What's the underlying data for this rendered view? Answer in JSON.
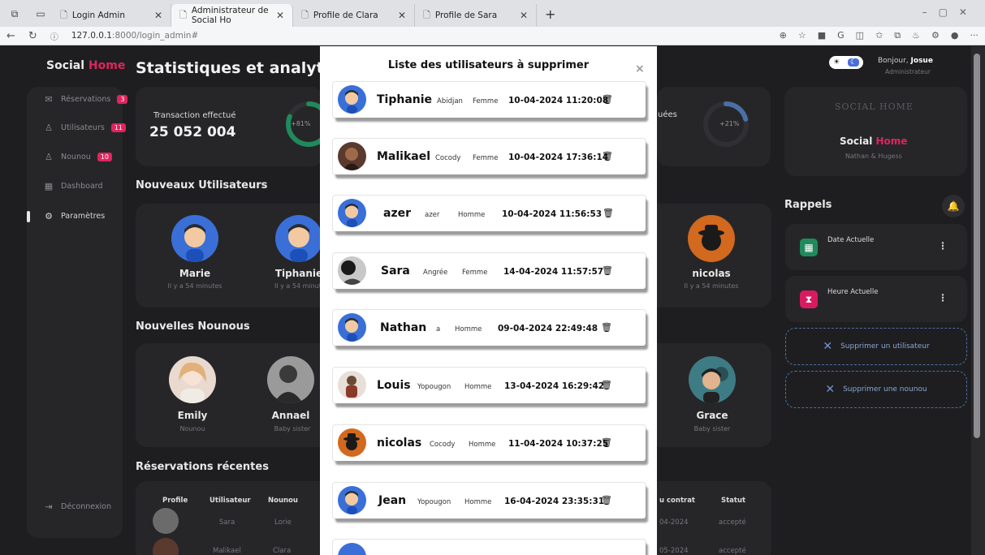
{
  "browser": {
    "tabs": [
      {
        "label": "Login Admin",
        "active": false
      },
      {
        "label": "Administrateur de Social Ho",
        "active": true
      },
      {
        "label": "Profile de Clara",
        "active": false
      },
      {
        "label": "Profile de Sara",
        "active": false
      }
    ],
    "url_host": "127.0.0.1",
    "url_rest": ":8000/login_admin#"
  },
  "app": {
    "brand_main": "Social",
    "brand_accent": "Home",
    "page_title": "Statistiques et analytique",
    "sidebar": [
      {
        "label": "Réservations",
        "badge": "3",
        "icon": "mail-icon"
      },
      {
        "label": "Utilisateurs",
        "badge": "11",
        "icon": "user-icon"
      },
      {
        "label": "Nounou",
        "badge": "10",
        "icon": "user-icon"
      },
      {
        "label": "Dashboard",
        "badge": "",
        "icon": "dashboard-icon"
      },
      {
        "label": "Paramètres",
        "badge": "",
        "icon": "gear-icon"
      },
      {
        "label": "Déconnexion",
        "badge": "",
        "icon": "logout-icon"
      }
    ],
    "stats": {
      "transaction_label": "Transaction effectué",
      "transaction_value": "25 052 004",
      "ring1_label": "+81%",
      "ring1_value": 81,
      "partial_label": "uées",
      "ring2_label": "+21%",
      "ring2_value": 21
    },
    "new_users_title": "Nouveaux Utilisateurs",
    "new_users": [
      {
        "name": "Marie",
        "sub": "Il y a 54 minutes"
      },
      {
        "name": "Tiphanie",
        "sub": "Il y a 54 minut"
      },
      {
        "name": "nicolas",
        "sub": "Il y a 54 minutes"
      }
    ],
    "new_nannies_title": "Nouvelles Nounous",
    "new_nannies": [
      {
        "name": "Emily",
        "sub": "Nounou"
      },
      {
        "name": "Annael",
        "sub": "Baby sister"
      },
      {
        "name": "Grace",
        "sub": "Baby sister"
      }
    ],
    "reservations_title": "Réservations récentes",
    "reservations_headers": [
      "Profile",
      "Utilisateur",
      "Nounou",
      "u contrat",
      "Statut"
    ],
    "reservations_rows": [
      {
        "user": "Sara",
        "nanny": "Lorie",
        "date": "04-2024",
        "status": "accepté"
      },
      {
        "user": "Malikael",
        "nanny": "Clara",
        "date": "05-2024",
        "status": "accepté"
      }
    ],
    "greeting_prefix": "Bonjour,",
    "greeting_name": "Josue",
    "role": "Administrateur",
    "profile_logo_text": "SOCIAL HOME",
    "profile_brand_main": "Social",
    "profile_brand_accent": "Home",
    "profile_sub": "Nathan & Hugess",
    "rappels_title": "Rappels",
    "reminders": [
      {
        "label": "Date Actuelle",
        "icon": "calendar-icon",
        "color": "#1f8a5b"
      },
      {
        "label": "Heure Actuelle",
        "icon": "hourglass-icon",
        "color": "#d81b60"
      }
    ],
    "delete_user_label": "Supprimer un utilisateur",
    "delete_nanny_label": "Supprimer une nounou"
  },
  "modal": {
    "title": "Liste des utilisateurs à supprimer",
    "close": "×",
    "users": [
      {
        "name": "Tiphanie",
        "location": "Abidjan",
        "gender": "Femme",
        "date": "10-04-2024 11:20:08"
      },
      {
        "name": "Malikael",
        "location": "Cocody",
        "gender": "Femme",
        "date": "10-04-2024 17:36:14"
      },
      {
        "name": "azer",
        "location": "azer",
        "gender": "Homme",
        "date": "10-04-2024 11:56:53"
      },
      {
        "name": "Sara",
        "location": "Angrée",
        "gender": "Femme",
        "date": "14-04-2024 11:57:57"
      },
      {
        "name": "Nathan",
        "location": "a",
        "gender": "Homme",
        "date": "09-04-2024 22:49:48"
      },
      {
        "name": "Louis",
        "location": "Yopougon",
        "gender": "Homme",
        "date": "13-04-2024 16:29:42"
      },
      {
        "name": "nicolas",
        "location": "Cocody",
        "gender": "Homme",
        "date": "11-04-2024 10:37:25"
      },
      {
        "name": "Jean",
        "location": "Yopougon",
        "gender": "Homme",
        "date": "16-04-2024 23:35:31"
      }
    ]
  },
  "colors": {
    "accent": "#e0245e",
    "green_ring": "#1f8a5b",
    "blue_ring": "#4a6fa5"
  }
}
